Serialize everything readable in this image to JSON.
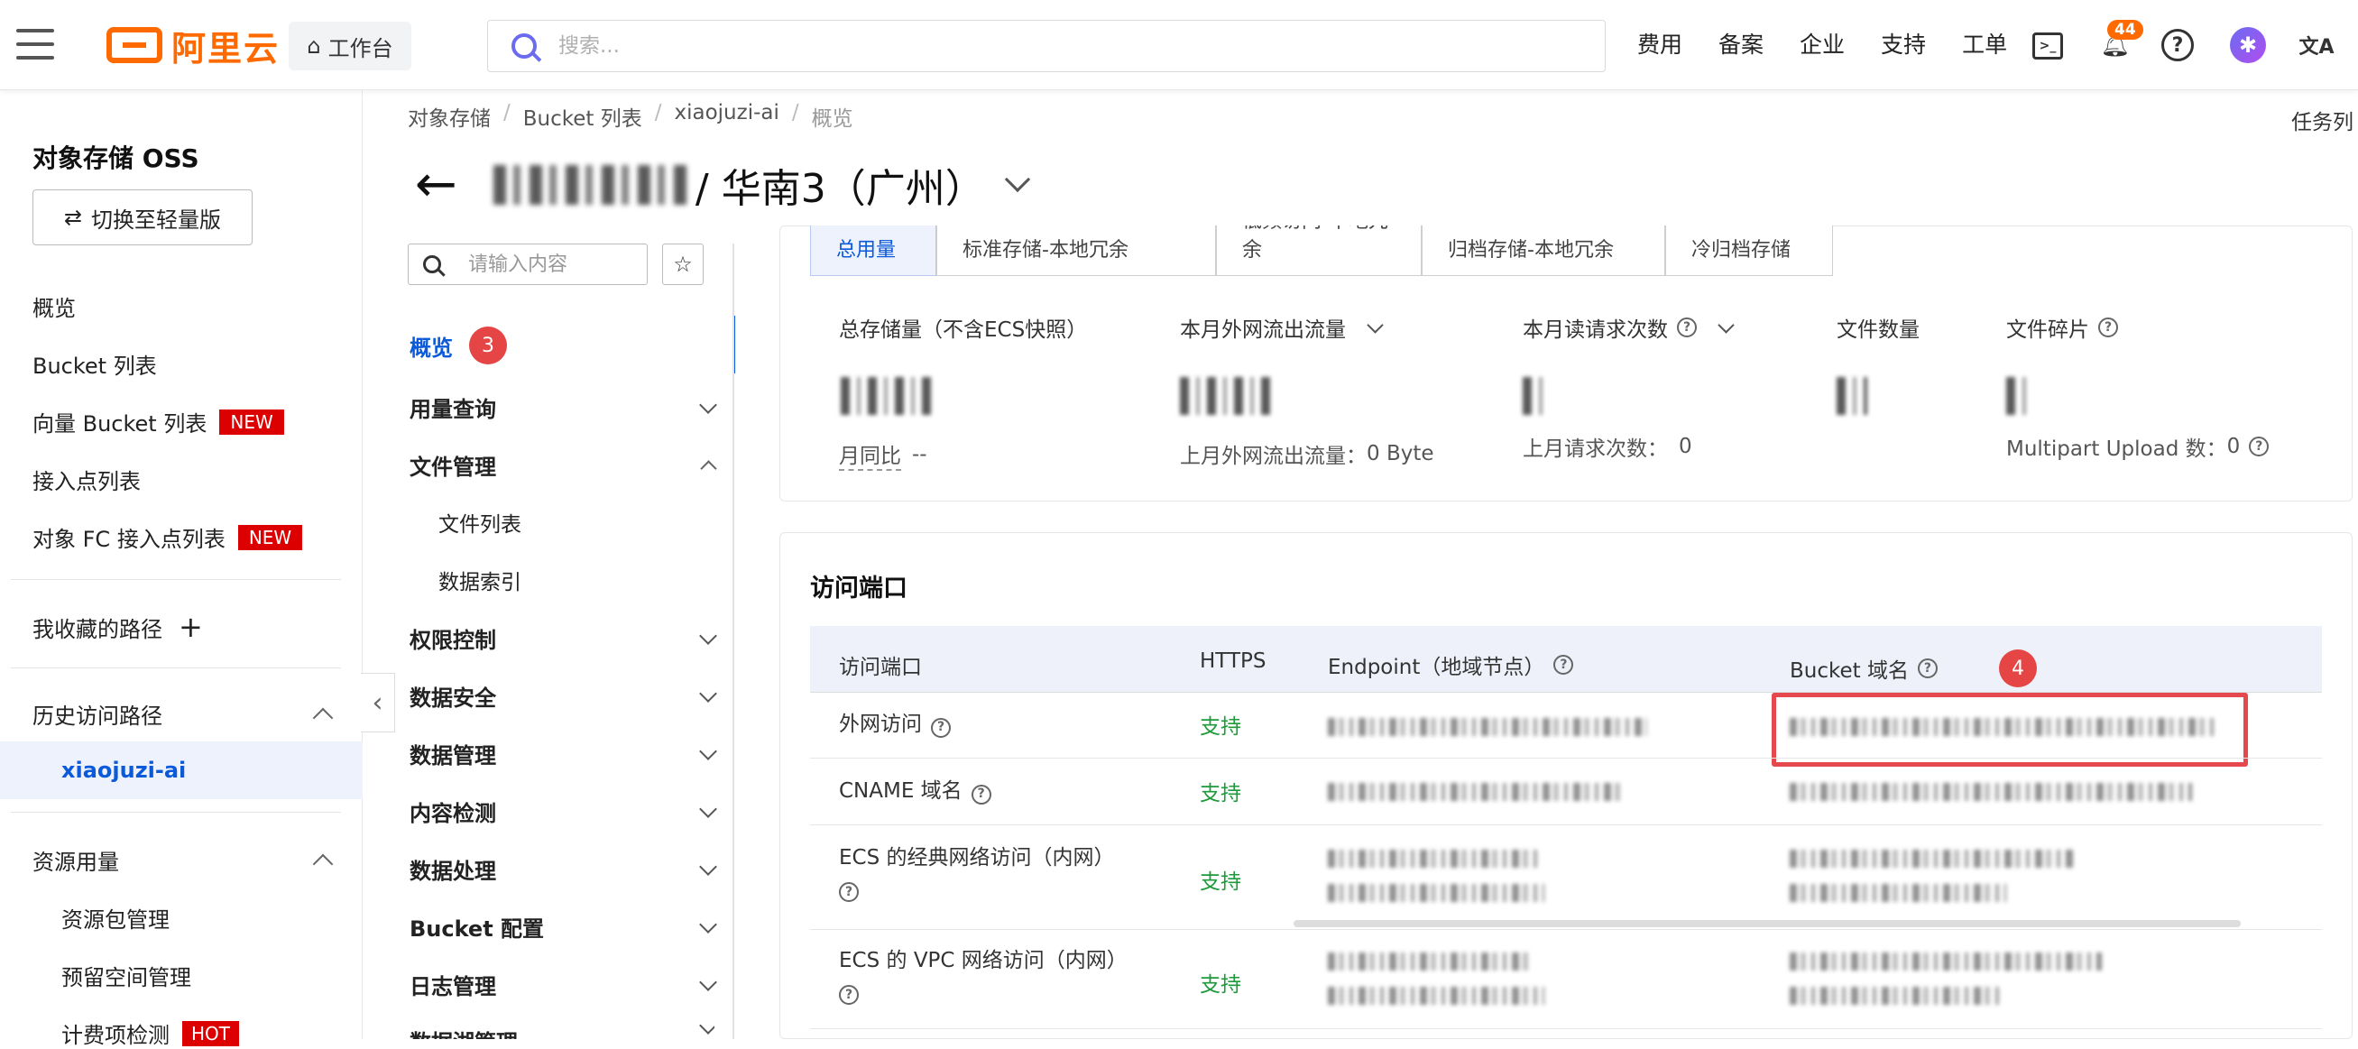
{
  "topbar": {
    "logo_text": "阿里云",
    "workbench_label": "工作台",
    "search_placeholder": "搜索...",
    "nav": [
      "费用",
      "备案",
      "企业",
      "支持",
      "工单"
    ],
    "notification_count": "44",
    "avatar_letter": "✱",
    "lang_glyph": "文A",
    "accent_color": "#ff6a00"
  },
  "sidebar": {
    "title": "对象存储 OSS",
    "switch_label": "切换至轻量版",
    "items": [
      "概览",
      "Bucket 列表",
      "向量 Bucket 列表",
      "接入点列表",
      "对象 FC 接入点列表"
    ],
    "new_badge": "NEW",
    "favorites_label": "我收藏的路径",
    "favorites_add": "+",
    "history_label": "历史访问路径",
    "history_active": "xiaojuzi-ai",
    "resource_label": "资源用量",
    "resource_items": [
      "资源包管理",
      "预留空间管理",
      "计费项检测"
    ],
    "hot_badge": "HOT"
  },
  "breadcrumb": [
    "对象存储",
    "Bucket 列表",
    "xiaojuzi-ai",
    "概览"
  ],
  "bucket_header": {
    "region": "/ 华南3（广州）",
    "tasklist": "任务列"
  },
  "bucket_nav": {
    "search_placeholder": "请输入内容",
    "overview": "概览",
    "overview_marker": "3",
    "items": [
      "用量查询",
      "文件管理",
      "权限控制",
      "数据安全",
      "数据管理",
      "内容检测",
      "数据处理",
      "Bucket 配置",
      "日志管理",
      "数据湖管理"
    ],
    "file_sub": [
      "文件列表",
      "数据索引"
    ]
  },
  "usage": {
    "tabs": [
      "总用量",
      "标准存储-本地冗余",
      "低频访问-本地冗余",
      "归档存储-本地冗余",
      "冷归档存储"
    ],
    "stats": [
      {
        "label": "总存储量（不含ECS快照）",
        "sub_label": "月同比",
        "sub_value": "--"
      },
      {
        "label": "本月外网流出流量",
        "sub_label": "上月外网流出流量：",
        "sub_value": "0 Byte"
      },
      {
        "label": "本月读请求次数",
        "sub_label": "上月请求次数：",
        "sub_value": "0"
      },
      {
        "label": "文件数量",
        "sub_label": "",
        "sub_value": ""
      },
      {
        "label": "文件碎片",
        "sub_label": "Multipart Upload 数：",
        "sub_value": "0"
      }
    ]
  },
  "access": {
    "title": "访问端口",
    "headers": [
      "访问端口",
      "HTTPS",
      "Endpoint（地域节点）",
      "Bucket 域名"
    ],
    "bucket_domain_marker": "4",
    "rows": [
      {
        "name": "外网访问",
        "https": "支持"
      },
      {
        "name": "CNAME 域名",
        "https": "支持"
      },
      {
        "name": "ECS 的经典网络访问（内网）",
        "https": "支持"
      },
      {
        "name": "ECS 的 VPC 网络访问（内网）",
        "https": "支持"
      }
    ]
  }
}
